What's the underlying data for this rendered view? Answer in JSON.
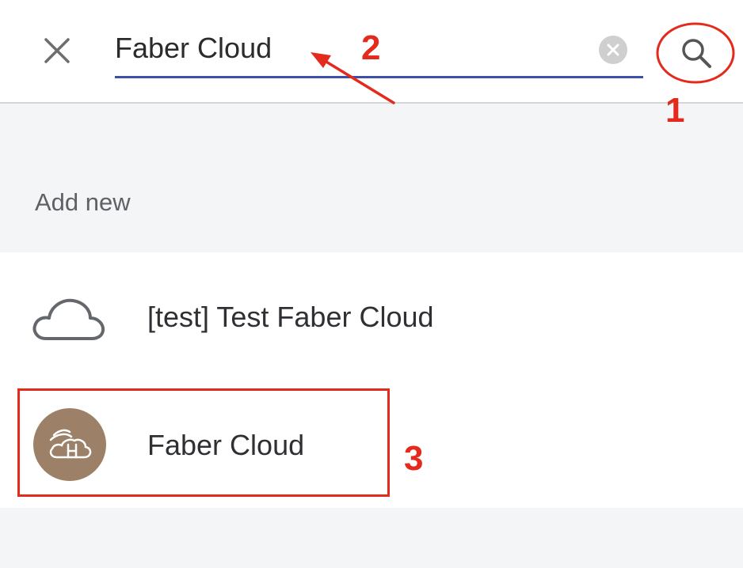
{
  "search": {
    "value": "Faber Cloud",
    "placeholder": "",
    "close_icon": "close-icon",
    "clear_icon": "clear-icon",
    "search_icon": "search-icon"
  },
  "section": {
    "label": "Add new"
  },
  "results": [
    {
      "label": "[test] Test Faber Cloud",
      "icon": "cloud-icon"
    },
    {
      "label": "Faber Cloud",
      "icon": "faber-cloud-logo-icon"
    }
  ],
  "annotations": {
    "step1": "1",
    "step2": "2",
    "step3": "3",
    "color": "#e32a1d"
  },
  "colors": {
    "accent": "#3d4fa6",
    "section_background": "#f4f5f7",
    "avatar_background": "#9c8068"
  }
}
